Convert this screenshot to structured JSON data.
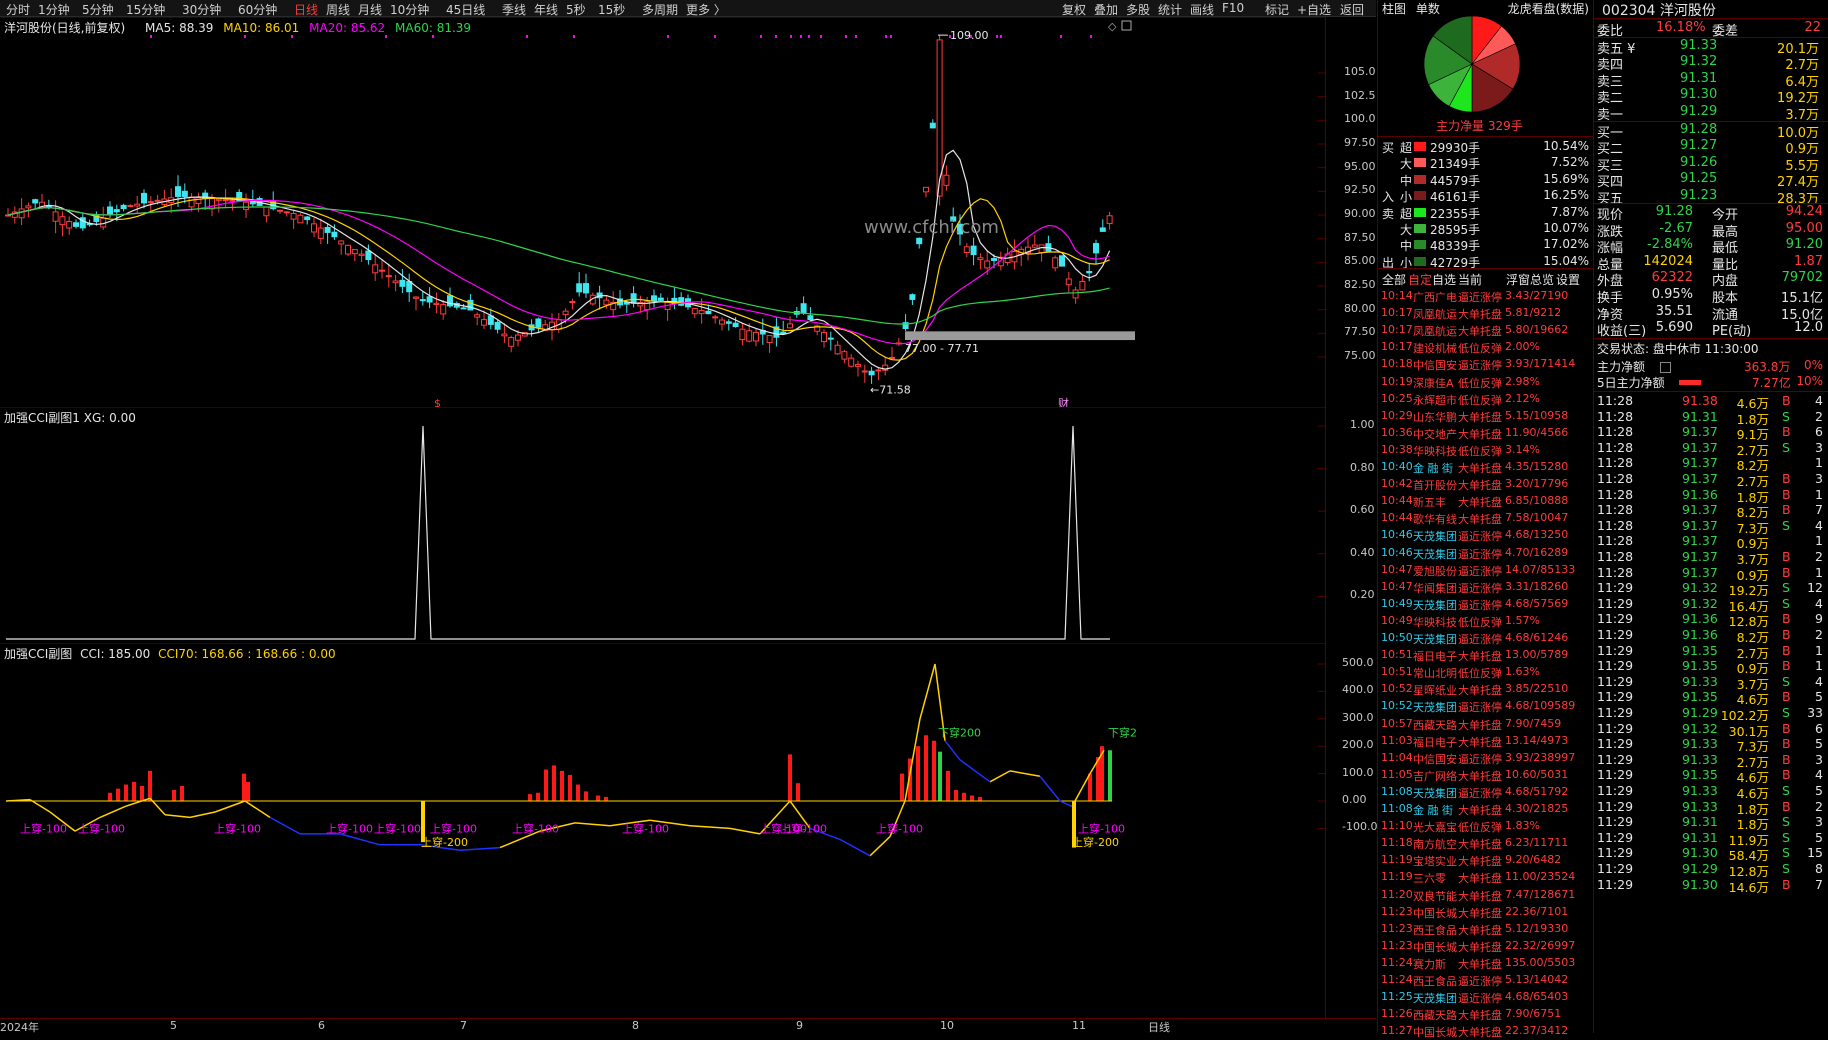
{
  "toolbar": {
    "periods": [
      "分时",
      "1分钟",
      "5分钟",
      "15分钟",
      "30分钟",
      "60分钟",
      "日线",
      "周线",
      "月线",
      "10分钟",
      "45日线",
      "季线",
      "年线",
      "5秒",
      "15秒",
      "多周期",
      "更多 〉"
    ],
    "active_period": "日线",
    "tools": [
      "复权",
      "叠加",
      "多股",
      "统计",
      "画线",
      "F10",
      "标记",
      "+自选",
      "返回"
    ]
  },
  "main_chart": {
    "title": "洋河股份(日线,前复权)",
    "ma5": "MA5: 88.39",
    "ma10": "MA10: 86.01",
    "ma20": "MA20: 85.62",
    "ma60": "MA60: 81.39",
    "y_ticks": [
      "105.0",
      "102.5",
      "100.0",
      "97.50",
      "95.00",
      "92.50",
      "90.00",
      "87.50",
      "85.00",
      "82.50",
      "80.00",
      "77.50",
      "75.00"
    ],
    "high_label": "109.00",
    "low_label": "71.58",
    "range_label": "77.00 - 77.71",
    "watermark": "www.cfchi.com",
    "markers": [
      "$",
      "财"
    ],
    "colors": {
      "ma5": "#e6e6e6",
      "ma10": "#ffd200",
      "ma20": "#ff00ff",
      "ma60": "#2fd34a",
      "up": "#ff3b3b",
      "down": "#3ee6f0"
    }
  },
  "sub1": {
    "title": "加强CCI副图1 XG: 0.00",
    "y_ticks": [
      "1.00",
      "0.80",
      "0.60",
      "0.40",
      "0.20"
    ]
  },
  "sub2": {
    "title_prefix": "加强CCI副图",
    "cci": "CCI: 185.00",
    "cci70": "CCI70: 168.66 : 168.66 : 0.00",
    "y_ticks": [
      "500.0",
      "400.0",
      "300.0",
      "200.0",
      "100.0",
      "0.00",
      "-100.0"
    ],
    "labels_up100": [
      "上穿-100",
      "上穿-100",
      "上穿-100",
      "上穿-100",
      "上穿-100",
      "上穿-100",
      "上穿-100",
      "上穿-100",
      "上穿-100",
      "上穿-100",
      "上穿-100",
      "上穿-100"
    ],
    "label_up200a": "上穿-200",
    "label_up200b": "上穿-200",
    "label_down200a": "下穿200",
    "label_down200b": "下穿2"
  },
  "x_axis": [
    "2024年",
    "5",
    "6",
    "7",
    "8",
    "9",
    "10",
    "11",
    "日线"
  ],
  "mid_panel": {
    "tabs": [
      "柱图",
      "单数"
    ],
    "dragon_tiger": "龙虎看盘(数据)",
    "net_main": "主力净量 329手",
    "flow": [
      {
        "side": "买",
        "size": "超",
        "vol": "29930手",
        "pct": "10.54%",
        "color": "#ff1a1a"
      },
      {
        "side": "",
        "size": "大",
        "vol": "21349手",
        "pct": "7.52%",
        "color": "#ff5a5a"
      },
      {
        "side": "",
        "size": "中",
        "vol": "44579手",
        "pct": "15.69%",
        "color": "#b02a2a"
      },
      {
        "side": "入",
        "size": "小",
        "vol": "46161手",
        "pct": "16.25%",
        "color": "#7a1a1a"
      },
      {
        "side": "卖",
        "size": "超",
        "vol": "22355手",
        "pct": "7.87%",
        "color": "#1ee61e"
      },
      {
        "side": "",
        "size": "大",
        "vol": "28595手",
        "pct": "10.07%",
        "color": "#3cb43c"
      },
      {
        "side": "",
        "size": "中",
        "vol": "48339手",
        "pct": "17.02%",
        "color": "#2a8a2a"
      },
      {
        "side": "出",
        "size": "小",
        "vol": "42729手",
        "pct": "15.04%",
        "color": "#1e6a1e"
      }
    ],
    "filter_tabs": [
      "全部",
      "自定",
      "自选",
      "当前",
      "浮窗",
      "总览",
      "设置"
    ],
    "news": [
      {
        "t": "10:14",
        "name": "广西广电",
        "type": "逼近涨停",
        "val": "3.43/27190",
        "c": "red"
      },
      {
        "t": "10:17",
        "name": "凤凰航运",
        "type": "大单托盘",
        "val": "5.81/9212",
        "c": "red"
      },
      {
        "t": "10:17",
        "name": "凤凰航运",
        "type": "大单托盘",
        "val": "5.80/19662",
        "c": "red"
      },
      {
        "t": "10:17",
        "name": "建设机械",
        "type": "低位反弹",
        "val": "2.00%",
        "c": "red"
      },
      {
        "t": "10:18",
        "name": "中信国安",
        "type": "逼近涨停",
        "val": "3.93/171414",
        "c": "red"
      },
      {
        "t": "10:19",
        "name": "深康佳A",
        "type": "低位反弹",
        "val": "2.98%",
        "c": "red"
      },
      {
        "t": "10:25",
        "name": "永辉超市",
        "type": "低位反弹",
        "val": "2.12%",
        "c": "red"
      },
      {
        "t": "10:29",
        "name": "山东华鹏",
        "type": "大单托盘",
        "val": "5.15/10958",
        "c": "red"
      },
      {
        "t": "10:36",
        "name": "中交地产",
        "type": "大单托盘",
        "val": "11.90/4566",
        "c": "red"
      },
      {
        "t": "10:38",
        "name": "华映科技",
        "type": "低位反弹",
        "val": "3.14%",
        "c": "red"
      },
      {
        "t": "10:40",
        "name": "金 融 街",
        "type": "大单托盘",
        "val": "4.35/15280",
        "c": "cyan"
      },
      {
        "t": "10:42",
        "name": "首开股份",
        "type": "大单托盘",
        "val": "3.20/17796",
        "c": "red"
      },
      {
        "t": "10:44",
        "name": "新五丰",
        "type": "大单托盘",
        "val": "6.85/10888",
        "c": "red"
      },
      {
        "t": "10:44",
        "name": "歌华有线",
        "type": "大单托盘",
        "val": "7.58/10047",
        "c": "red"
      },
      {
        "t": "10:46",
        "name": "天茂集团",
        "type": "逼近涨停",
        "val": "4.68/13250",
        "c": "cyan"
      },
      {
        "t": "10:46",
        "name": "天茂集团",
        "type": "逼近涨停",
        "val": "4.70/16289",
        "c": "cyan"
      },
      {
        "t": "10:47",
        "name": "爱旭股份",
        "type": "逼近涨停",
        "val": "14.07/85133",
        "c": "red"
      },
      {
        "t": "10:47",
        "name": "华闻集团",
        "type": "逼近涨停",
        "val": "3.31/18260",
        "c": "red"
      },
      {
        "t": "10:49",
        "name": "天茂集团",
        "type": "逼近涨停",
        "val": "4.68/57569",
        "c": "cyan"
      },
      {
        "t": "10:49",
        "name": "华映科技",
        "type": "低位反弹",
        "val": "1.57%",
        "c": "red"
      },
      {
        "t": "10:50",
        "name": "天茂集团",
        "type": "逼近涨停",
        "val": "4.68/61246",
        "c": "cyan"
      },
      {
        "t": "10:51",
        "name": "福日电子",
        "type": "大单托盘",
        "val": "13.00/5789",
        "c": "red"
      },
      {
        "t": "10:51",
        "name": "常山北明",
        "type": "低位反弹",
        "val": "1.63%",
        "c": "red"
      },
      {
        "t": "10:52",
        "name": "星晖纸业",
        "type": "大单托盘",
        "val": "3.85/22510",
        "c": "red"
      },
      {
        "t": "10:52",
        "name": "天茂集团",
        "type": "逼近涨停",
        "val": "4.68/109589",
        "c": "cyan"
      },
      {
        "t": "10:57",
        "name": "西藏天路",
        "type": "大单托盘",
        "val": "7.90/7459",
        "c": "red"
      },
      {
        "t": "11:03",
        "name": "福日电子",
        "type": "大单托盘",
        "val": "13.14/4973",
        "c": "red"
      },
      {
        "t": "11:04",
        "name": "中信国安",
        "type": "逼近涨停",
        "val": "3.93/238997",
        "c": "red"
      },
      {
        "t": "11:05",
        "name": "吉广网络",
        "type": "大单托盘",
        "val": "10.60/5031",
        "c": "red"
      },
      {
        "t": "11:08",
        "name": "天茂集团",
        "type": "逼近涨停",
        "val": "4.68/51792",
        "c": "cyan"
      },
      {
        "t": "11:08",
        "name": "金 融 街",
        "type": "大单托盘",
        "val": "4.30/21825",
        "c": "cyan"
      },
      {
        "t": "11:10",
        "name": "光大嘉宝",
        "type": "低位反弹",
        "val": "1.83%",
        "c": "red"
      },
      {
        "t": "11:18",
        "name": "南方航空",
        "type": "大单托盘",
        "val": "6.23/11711",
        "c": "red"
      },
      {
        "t": "11:19",
        "name": "宝塔实业",
        "type": "大单托盘",
        "val": "9.20/6482",
        "c": "red"
      },
      {
        "t": "11:19",
        "name": "三六零",
        "type": "大单托盘",
        "val": "11.00/23524",
        "c": "red"
      },
      {
        "t": "11:20",
        "name": "双良节能",
        "type": "大单托盘",
        "val": "7.47/128671",
        "c": "red"
      },
      {
        "t": "11:23",
        "name": "中国长城",
        "type": "大单托盘",
        "val": "22.36/7101",
        "c": "red"
      },
      {
        "t": "11:23",
        "name": "西王食品",
        "type": "大单托盘",
        "val": "5.12/19330",
        "c": "red"
      },
      {
        "t": "11:23",
        "name": "中国长城",
        "type": "大单托盘",
        "val": "22.32/26997",
        "c": "red"
      },
      {
        "t": "11:24",
        "name": "赛力斯",
        "type": "大单托盘",
        "val": "135.00/5503",
        "c": "red"
      },
      {
        "t": "11:24",
        "name": "西王食品",
        "type": "逼近涨停",
        "val": "5.13/14042",
        "c": "red"
      },
      {
        "t": "11:25",
        "name": "天茂集团",
        "type": "逼近涨停",
        "val": "4.68/65403",
        "c": "cyan"
      },
      {
        "t": "11:26",
        "name": "西藏天路",
        "type": "大单托盘",
        "val": "7.90/6751",
        "c": "red"
      },
      {
        "t": "11:27",
        "name": "中国长城",
        "type": "大单托盘",
        "val": "22.37/3412",
        "c": "red"
      }
    ]
  },
  "quote": {
    "code_name": "002304 洋河股份",
    "wb_label": "委比",
    "wb_val": "16.18%",
    "wc_label": "委差",
    "wc_val": "22",
    "asks": [
      {
        "l": "卖五 ¥",
        "p": "91.33",
        "v": "20.1万"
      },
      {
        "l": "卖四",
        "p": "91.32",
        "v": "2.7万"
      },
      {
        "l": "卖三",
        "p": "91.31",
        "v": "6.4万"
      },
      {
        "l": "卖二",
        "p": "91.30",
        "v": "19.2万"
      },
      {
        "l": "卖一",
        "p": "91.29",
        "v": "3.7万"
      }
    ],
    "bids": [
      {
        "l": "买一",
        "p": "91.28",
        "v": "10.0万"
      },
      {
        "l": "买二",
        "p": "91.27",
        "v": "0.9万"
      },
      {
        "l": "买三",
        "p": "91.26",
        "v": "5.5万"
      },
      {
        "l": "买四",
        "p": "91.25",
        "v": "27.4万"
      },
      {
        "l": "买五",
        "p": "91.23",
        "v": "28.3万"
      }
    ],
    "stats": [
      {
        "a": "现价",
        "av": "91.28",
        "ac": "green",
        "b": "今开",
        "bv": "94.24",
        "bc": "red"
      },
      {
        "a": "涨跌",
        "av": "-2.67",
        "ac": "green",
        "b": "最高",
        "bv": "95.00",
        "bc": "red"
      },
      {
        "a": "涨幅",
        "av": "-2.84%",
        "ac": "green",
        "b": "最低",
        "bv": "91.20",
        "bc": "green"
      },
      {
        "a": "总量",
        "av": "142024",
        "ac": "yellow",
        "b": "量比",
        "bv": "1.87",
        "bc": "red"
      },
      {
        "a": "外盘",
        "av": "62322",
        "ac": "red",
        "b": "内盘",
        "bv": "79702",
        "bc": "green"
      },
      {
        "a": "换手",
        "av": "0.95%",
        "ac": "white",
        "b": "股本",
        "bv": "15.1亿",
        "bc": "white"
      },
      {
        "a": "净资",
        "av": "35.51",
        "ac": "white",
        "b": "流通",
        "bv": "15.0亿",
        "bc": "white"
      },
      {
        "a": "收益(三)",
        "av": "5.690",
        "ac": "white",
        "b": "PE(动)",
        "bv": "12.0",
        "bc": "white"
      }
    ],
    "trade_status": "交易状态: 盘中休市 11:30:00",
    "main_net_label": "主力净额",
    "main_net_val": "363.8万",
    "main_net_pct": "0%",
    "main5_label": "5日主力净额",
    "main5_val": "7.27亿",
    "main5_pct": "10%",
    "ticks": [
      {
        "t": "11:28",
        "p": "91.38",
        "pc": "red",
        "v": "4.6万",
        "s": "B",
        "n": "4"
      },
      {
        "t": "11:28",
        "p": "91.31",
        "pc": "green",
        "v": "1.8万",
        "s": "S",
        "n": "2"
      },
      {
        "t": "11:28",
        "p": "91.37",
        "pc": "green",
        "v": "9.1万",
        "s": "B",
        "n": "6"
      },
      {
        "t": "11:28",
        "p": "91.37",
        "pc": "green",
        "v": "2.7万",
        "s": "S",
        "n": "3"
      },
      {
        "t": "11:28",
        "p": "91.37",
        "pc": "green",
        "v": "8.2万",
        "s": "",
        "n": "1"
      },
      {
        "t": "11:28",
        "p": "91.37",
        "pc": "green",
        "v": "2.7万",
        "s": "B",
        "n": "3"
      },
      {
        "t": "11:28",
        "p": "91.36",
        "pc": "green",
        "v": "1.8万",
        "s": "B",
        "n": "1"
      },
      {
        "t": "11:28",
        "p": "91.37",
        "pc": "green",
        "v": "8.2万",
        "s": "B",
        "n": "7"
      },
      {
        "t": "11:28",
        "p": "91.37",
        "pc": "green",
        "v": "7.3万",
        "s": "S",
        "n": "4"
      },
      {
        "t": "11:28",
        "p": "91.37",
        "pc": "green",
        "v": "0.9万",
        "s": "",
        "n": "1"
      },
      {
        "t": "11:28",
        "p": "91.37",
        "pc": "green",
        "v": "3.7万",
        "s": "B",
        "n": "2"
      },
      {
        "t": "11:28",
        "p": "91.37",
        "pc": "green",
        "v": "0.9万",
        "s": "B",
        "n": "1"
      },
      {
        "t": "11:29",
        "p": "91.32",
        "pc": "green",
        "v": "19.2万",
        "s": "S",
        "n": "12"
      },
      {
        "t": "11:29",
        "p": "91.32",
        "pc": "green",
        "v": "16.4万",
        "s": "S",
        "n": "4"
      },
      {
        "t": "11:29",
        "p": "91.36",
        "pc": "green",
        "v": "12.8万",
        "s": "B",
        "n": "9"
      },
      {
        "t": "11:29",
        "p": "91.36",
        "pc": "green",
        "v": "8.2万",
        "s": "B",
        "n": "2"
      },
      {
        "t": "11:29",
        "p": "91.35",
        "pc": "green",
        "v": "2.7万",
        "s": "B",
        "n": "1"
      },
      {
        "t": "11:29",
        "p": "91.35",
        "pc": "green",
        "v": "0.9万",
        "s": "B",
        "n": "1"
      },
      {
        "t": "11:29",
        "p": "91.33",
        "pc": "green",
        "v": "3.7万",
        "s": "S",
        "n": "4"
      },
      {
        "t": "11:29",
        "p": "91.35",
        "pc": "green",
        "v": "4.6万",
        "s": "B",
        "n": "5"
      },
      {
        "t": "11:29",
        "p": "91.29",
        "pc": "green",
        "v": "102.2万",
        "s": "S",
        "n": "33"
      },
      {
        "t": "11:29",
        "p": "91.32",
        "pc": "green",
        "v": "30.1万",
        "s": "B",
        "n": "6"
      },
      {
        "t": "11:29",
        "p": "91.33",
        "pc": "green",
        "v": "7.3万",
        "s": "B",
        "n": "5"
      },
      {
        "t": "11:29",
        "p": "91.33",
        "pc": "green",
        "v": "2.7万",
        "s": "B",
        "n": "3"
      },
      {
        "t": "11:29",
        "p": "91.35",
        "pc": "green",
        "v": "4.6万",
        "s": "B",
        "n": "4"
      },
      {
        "t": "11:29",
        "p": "91.33",
        "pc": "green",
        "v": "4.6万",
        "s": "S",
        "n": "5"
      },
      {
        "t": "11:29",
        "p": "91.33",
        "pc": "green",
        "v": "1.8万",
        "s": "B",
        "n": "2"
      },
      {
        "t": "11:29",
        "p": "91.31",
        "pc": "green",
        "v": "1.8万",
        "s": "S",
        "n": "3"
      },
      {
        "t": "11:29",
        "p": "91.31",
        "pc": "green",
        "v": "11.9万",
        "s": "S",
        "n": "5"
      },
      {
        "t": "11:29",
        "p": "91.30",
        "pc": "green",
        "v": "58.4万",
        "s": "S",
        "n": "15"
      },
      {
        "t": "11:29",
        "p": "91.29",
        "pc": "green",
        "v": "12.8万",
        "s": "S",
        "n": "8"
      },
      {
        "t": "11:29",
        "p": "91.30",
        "pc": "green",
        "v": "14.6万",
        "s": "B",
        "n": "7"
      }
    ]
  }
}
